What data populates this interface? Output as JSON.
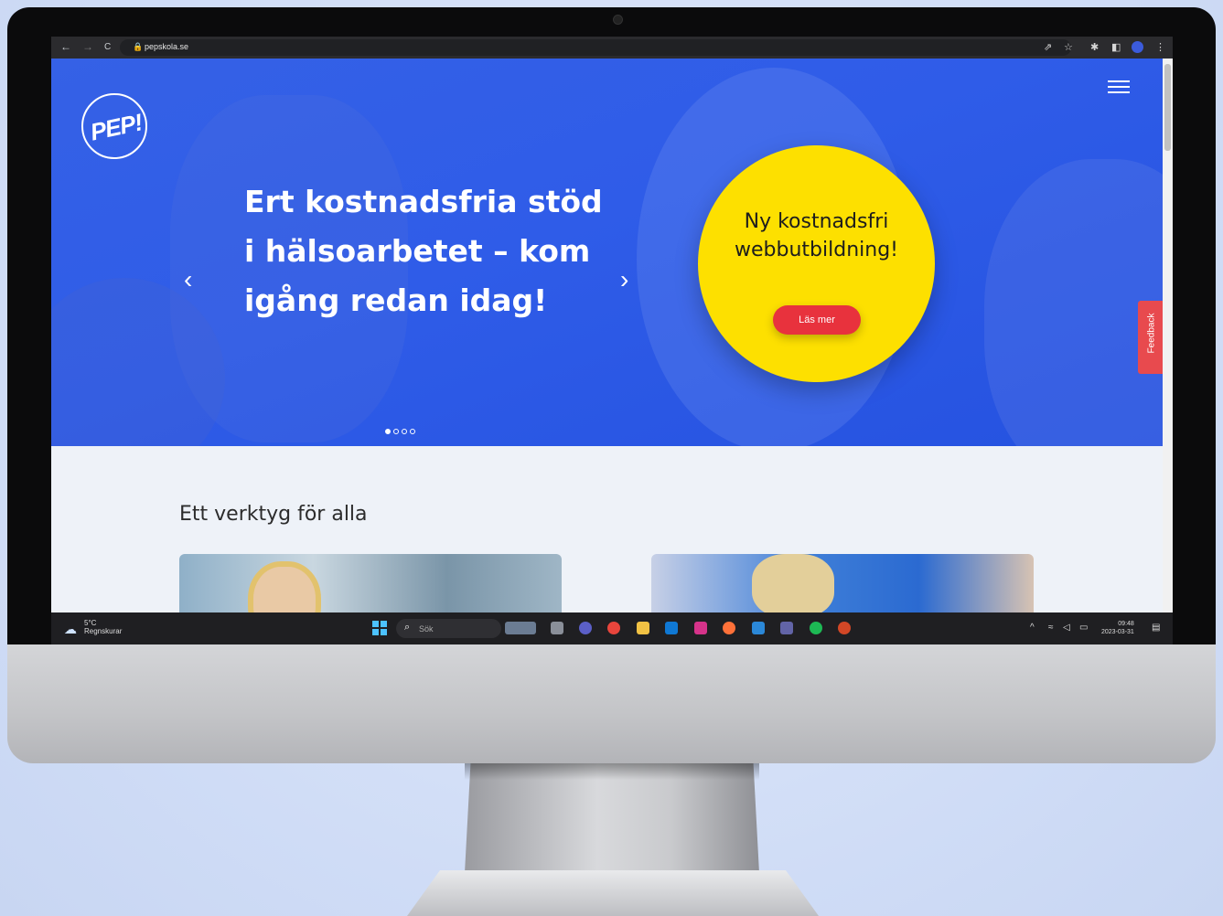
{
  "browser": {
    "url": "pepskola.se",
    "back_icon": "←",
    "forward_icon": "→",
    "reload_icon": "C",
    "lock_icon": "🔒",
    "share_icon": "⇗",
    "star_icon": "☆",
    "extensions_icon": "✱",
    "sidepanel_icon": "◧",
    "kebab_icon": "⋮"
  },
  "hero": {
    "logo_text": "PEP!",
    "headline": "Ert kostnadsfria stöd i hälsoarbetet – kom igång redan idag!",
    "prev_arrow": "‹",
    "next_arrow": "›",
    "promo_title": "Ny kostnadsfri webbutbildning!",
    "promo_button": "Läs mer",
    "feedback_label": "Feedback",
    "slides_total": 4,
    "slides_active": 1
  },
  "section": {
    "title": "Ett verktyg för alla"
  },
  "taskbar": {
    "weather_temp": "5°C",
    "weather_desc": "Regnskurar",
    "search_placeholder": "Sök",
    "search_icon": "⌕",
    "tray_chevron": "^",
    "time": "09:48",
    "date": "2023-03-31"
  },
  "colors": {
    "hero_blue": "#2f5ce8",
    "promo_yellow": "#fde000",
    "button_red": "#e8323d",
    "feedback_red": "#e84a4e"
  }
}
